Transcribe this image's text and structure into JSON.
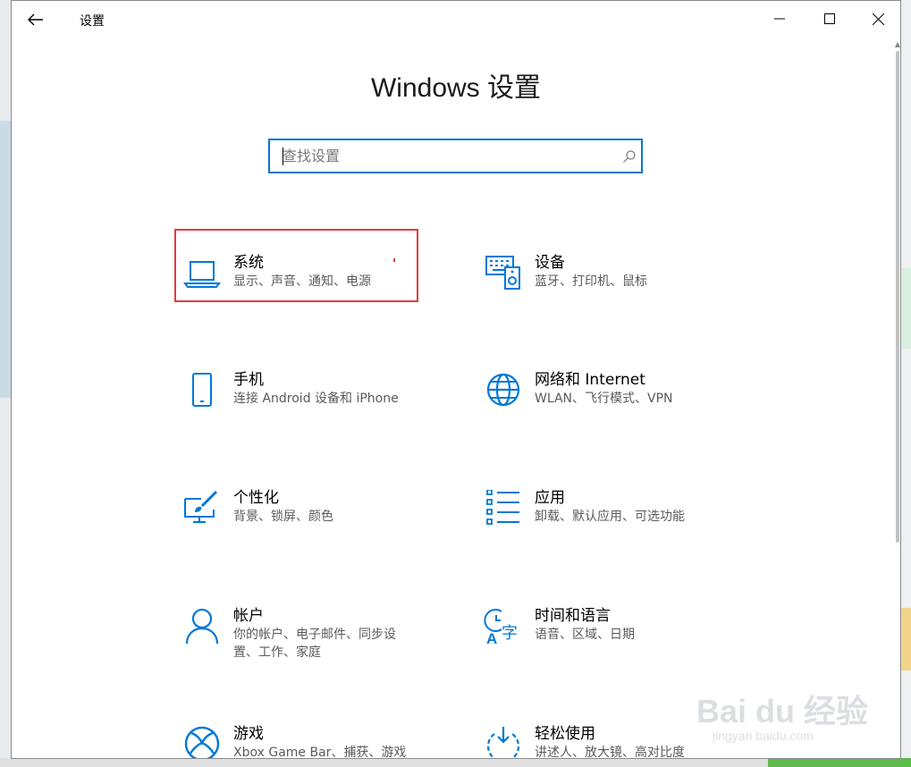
{
  "window": {
    "title": "设置"
  },
  "page": {
    "heading": "Windows 设置"
  },
  "search": {
    "placeholder": "查找设置",
    "value": ""
  },
  "tiles": [
    {
      "name": "系统",
      "desc": "显示、声音、通知、电源",
      "icon": "laptop-icon",
      "highlighted": true
    },
    {
      "name": "设备",
      "desc": "蓝牙、打印机、鼠标",
      "icon": "devices-icon"
    },
    {
      "name": "手机",
      "desc": "连接 Android 设备和 iPhone",
      "icon": "phone-icon"
    },
    {
      "name": "网络和 Internet",
      "desc": "WLAN、飞行模式、VPN",
      "icon": "globe-icon"
    },
    {
      "name": "个性化",
      "desc": "背景、锁屏、颜色",
      "icon": "personalization-icon"
    },
    {
      "name": "应用",
      "desc": "卸载、默认应用、可选功能",
      "icon": "apps-list-icon"
    },
    {
      "name": "帐户",
      "desc": "你的帐户、电子邮件、同步设置、工作、家庭",
      "icon": "person-icon"
    },
    {
      "name": "时间和语言",
      "desc": "语音、区域、日期",
      "icon": "time-language-icon"
    },
    {
      "name": "游戏",
      "desc": "Xbox Game Bar、捕获、游戏",
      "icon": "xbox-icon"
    },
    {
      "name": "轻松使用",
      "desc": "讲述人、放大镜、高对比度",
      "icon": "ease-of-access-icon"
    }
  ],
  "watermark": {
    "text": "Bai du 经验",
    "url": "jingyan.baidu.com"
  },
  "colors": {
    "accent": "#0078d7",
    "highlight": "#e53b3b"
  }
}
